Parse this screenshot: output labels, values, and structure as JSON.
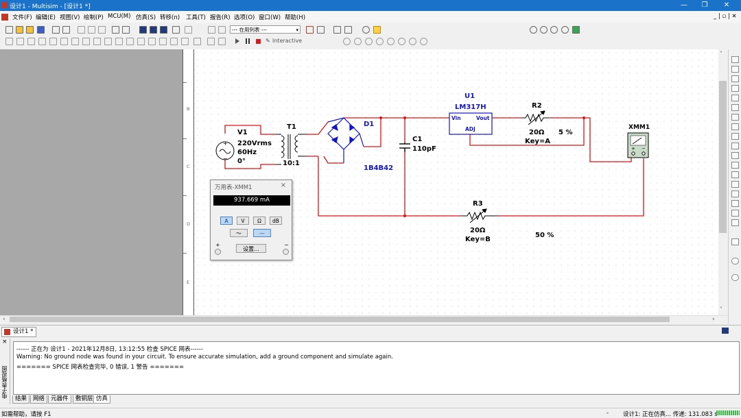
{
  "window": {
    "title": "设计1 - Multisim - [设计1 *]",
    "minimize": "—",
    "maximize": "❐",
    "close": "✕",
    "doc_restore": "_ | ▫ | ✕"
  },
  "menu": [
    "文件(F)",
    "编辑(E)",
    "视图(V)",
    "绘制(P)",
    "MCU(M)",
    "仿真(S)",
    "转移(n)",
    "工具(T)",
    "报告(R)",
    "选项(O)",
    "窗口(W)",
    "帮助(H)"
  ],
  "toolbar": {
    "in_use_list": "--- 在用列表 ---",
    "interactive_label": "Interactive"
  },
  "ruler": {
    "B": "B",
    "C": "C",
    "D": "D",
    "E": "E"
  },
  "schematic": {
    "v1": {
      "ref": "V1",
      "voltage": "220Vrms",
      "freq": "60Hz",
      "phase": "0°"
    },
    "t1": {
      "ref": "T1",
      "ratio": "10:1"
    },
    "d1": {
      "ref": "D1",
      "part": "1B4B42"
    },
    "c1": {
      "ref": "C1",
      "value": "110pF"
    },
    "u1": {
      "ref": "U1",
      "part": "LM317H",
      "vin": "Vin",
      "vout": "Vout",
      "adj": "ADJ"
    },
    "r2": {
      "ref": "R2",
      "value": "20Ω",
      "key": "Key=A",
      "percent": "5 %"
    },
    "r3": {
      "ref": "R3",
      "value": "20Ω",
      "key": "Key=B",
      "percent": "50 %"
    },
    "xmm1": {
      "ref": "XMM1",
      "plus": "+",
      "minus": "−"
    }
  },
  "multimeter": {
    "title": "万用表-XMM1",
    "reading": "937.669 mA",
    "modes": [
      "A",
      "V",
      "Ω",
      "dB"
    ],
    "active_mode": "A",
    "ac_symbol": "～",
    "dc_symbol": "—",
    "set_label": "设置...",
    "plus": "+",
    "minus": "−"
  },
  "doc_tab": "设计1 *",
  "output": {
    "side_label": "电子表格视图",
    "lines": [
      "------ 正在为 设计1 - 2021年12月8日, 13:12:55 检查 SPICE 网表------",
      "Warning: No ground node was found in your circuit. To ensure accurate simulation, add a ground component and simulate again.",
      "======= SPICE 网表检查完毕, 0 错误, 1 警告 ======="
    ],
    "tabs": [
      "结果",
      "网络",
      "元器件",
      "敷铜层",
      "仿真"
    ],
    "active_tab": "仿真"
  },
  "status": {
    "help": "如需帮助，请按 F1",
    "dash": "-",
    "sim": "设计1: 正在仿真... 传递: 131.083 s"
  },
  "colors": {
    "wire": "#e01010",
    "label_blue": "#1414c8",
    "titlebar": "#1a73c9"
  }
}
